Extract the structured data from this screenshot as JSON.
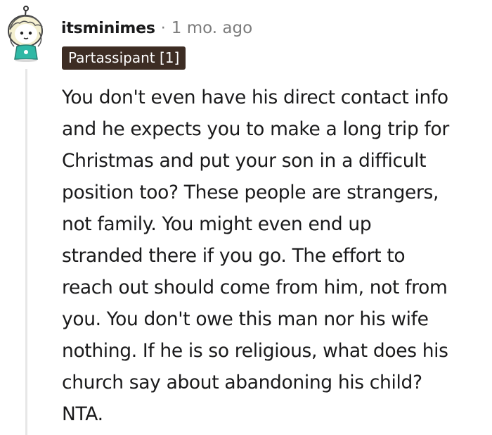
{
  "comment": {
    "author": "itsminimes",
    "separator": "·",
    "timestamp": "1 mo. ago",
    "flair": "Partassipant [1]",
    "avatar_icon": "snoo-avatar-icon",
    "flair_color": "#3d2d24",
    "body_lines": [
      "You don't even have his direct contact info",
      "and he expects you to make a long trip for",
      "Christmas and put your son in a difficult",
      "position too? These people are strangers,",
      "not family. You might even end up",
      "stranded there if you go. The effort to",
      "reach out should come from him, not from",
      "you. You don't owe this man nor his wife",
      "nothing. If he is so religious, what does his",
      "church say about abandoning his child?",
      "NTA."
    ]
  }
}
